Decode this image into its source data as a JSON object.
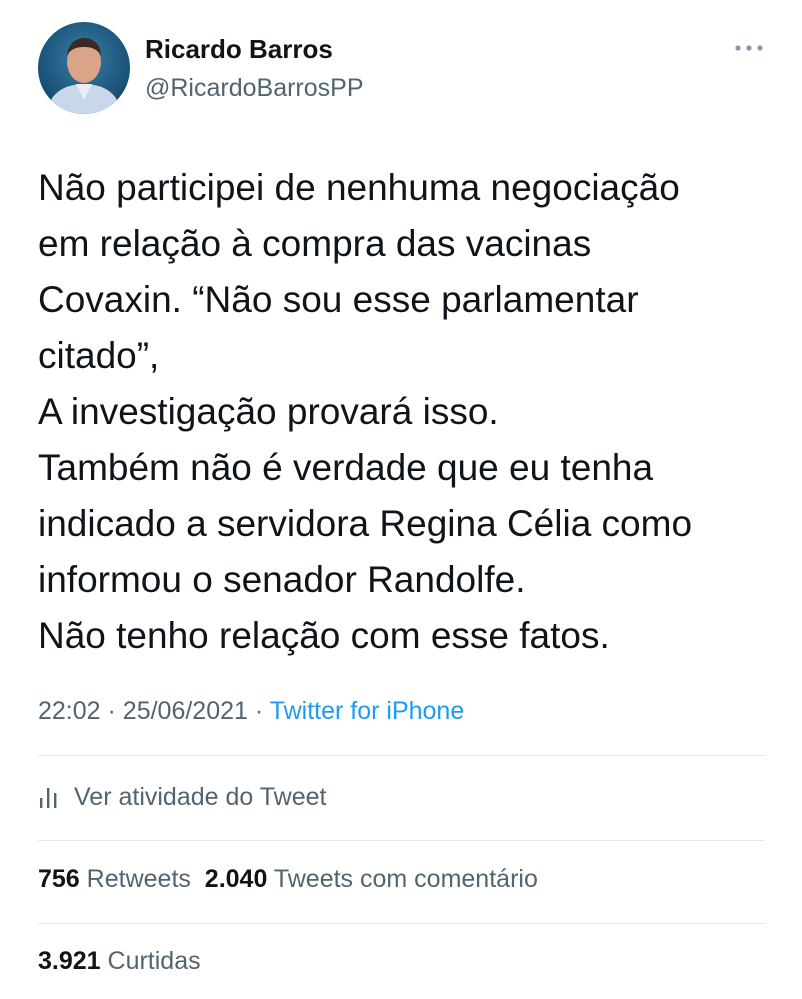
{
  "author": {
    "display_name": "Ricardo Barros",
    "handle": "@RicardoBarrosPP",
    "avatar_icon": "profile-photo"
  },
  "more_icon": "more-horizontal-icon",
  "tweet": {
    "text": "Não participei de nenhuma negociação\nem relação à compra das vacinas\nCovaxin. “Não sou esse parlamentar\ncitado”,\nA investigação provará isso.\nTambém não é verdade que eu tenha\nindicado a servidora Regina Célia como\ninformou o senador Randolfe.\nNão tenho relação com esse fatos."
  },
  "meta": {
    "time": "22:02",
    "separator": "·",
    "date": "25/06/2021",
    "source": "Twitter for iPhone"
  },
  "activity": {
    "icon": "stats-icon",
    "label": "Ver atividade do Tweet"
  },
  "stats": {
    "retweets_count": "756",
    "retweets_label": "Retweets",
    "quotes_count": "2.040",
    "quotes_label": "Tweets com comentário",
    "likes_count": "3.921",
    "likes_label": "Curtidas"
  },
  "colors": {
    "text_primary": "#0f1419",
    "text_secondary": "#536471",
    "link": "#1d9bf0",
    "divider": "#e4e8eb"
  }
}
